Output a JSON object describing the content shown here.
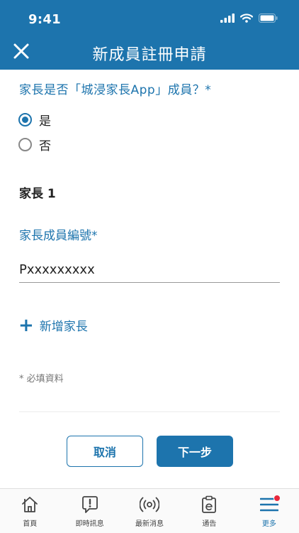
{
  "status_bar": {
    "time": "9:41"
  },
  "header": {
    "title": "新成員註冊申請"
  },
  "question": {
    "label": "家長是否「城浸家長App」成員？*",
    "options": [
      "是",
      "否"
    ],
    "selected": "是"
  },
  "parent_section": {
    "title": "家長 1",
    "field_label": "家長成員編號*",
    "field_value": "Pxxxxxxxxx"
  },
  "add_parent_label": "新增家長",
  "required_note": "* 必填資料",
  "buttons": {
    "cancel": "取消",
    "next": "下一步"
  },
  "tabs": [
    {
      "label": "首頁",
      "icon": "home-icon"
    },
    {
      "label": "即時訊息",
      "icon": "alert-message-icon"
    },
    {
      "label": "最新消息",
      "icon": "broadcast-icon"
    },
    {
      "label": "通告",
      "icon": "notice-icon"
    },
    {
      "label": "更多",
      "icon": "menu-icon",
      "active": true,
      "has_badge": true
    }
  ],
  "colors": {
    "primary": "#1d74ad",
    "badge": "#e8283c"
  }
}
